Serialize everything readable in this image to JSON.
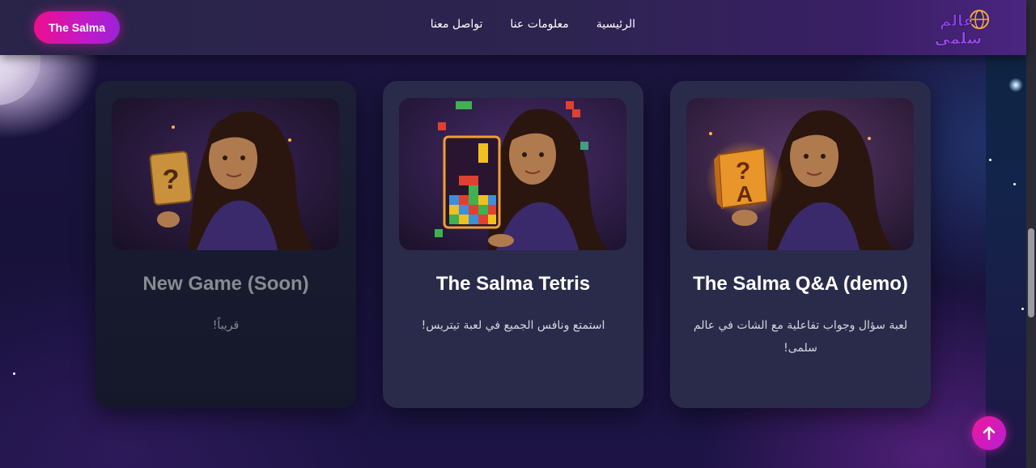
{
  "header": {
    "brand_button": "The Salma",
    "nav": [
      "الرئيسية",
      "معلومات عنا",
      "تواصل معنا"
    ],
    "logo_text_top": "عالم",
    "logo_text_bottom": "سلمى"
  },
  "games": [
    {
      "title": "The Salma Q&A (demo)",
      "description": "لعبة سؤال وجواب تفاعلية مع الشات في عالم سلمى!",
      "thumbnail_icon": "qa-cube-icon",
      "cube_letters": [
        "?",
        "A"
      ]
    },
    {
      "title": "The Salma Tetris",
      "description": "استمتع ونافس الجميع في لعبة تيتريس!",
      "thumbnail_icon": "tetris-board-icon"
    },
    {
      "title": "New Game (Soon)",
      "description": "قريباً!",
      "thumbnail_icon": "mystery-card-icon",
      "card_symbol": "?"
    }
  ],
  "scroll_top_icon": "arrow-up-icon",
  "colors": {
    "accent_pink": "#ec0f8c",
    "accent_purple": "#9b22d8",
    "card_bg": "#2a2b4a",
    "card_glow": "#ffb347"
  }
}
